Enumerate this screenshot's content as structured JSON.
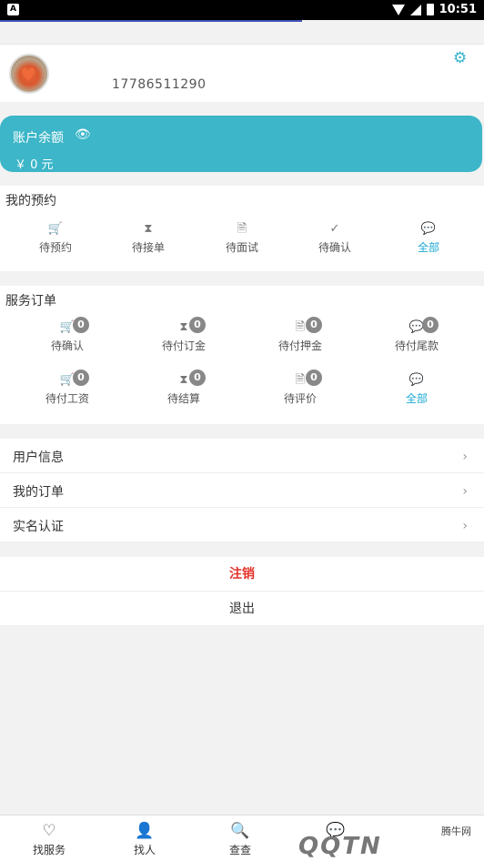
{
  "statusbar": {
    "time": "10:51",
    "app_icon": "A"
  },
  "profile": {
    "phone": "17786511290"
  },
  "balance": {
    "label": "账户余额",
    "amount": "￥ 0 元"
  },
  "appointments": {
    "title": "我的预约",
    "items": [
      {
        "label": "待预约",
        "icon": "cart-icon"
      },
      {
        "label": "待接单",
        "icon": "hourglass-icon"
      },
      {
        "label": "待面试",
        "icon": "document-icon"
      },
      {
        "label": "待确认",
        "icon": "check-icon"
      },
      {
        "label": "全部",
        "icon": "chat-icon"
      }
    ]
  },
  "service_orders": {
    "title": "服务订单",
    "items": [
      {
        "label": "待确认",
        "badge": "0",
        "icon": "cart-icon"
      },
      {
        "label": "待付订金",
        "badge": "0",
        "icon": "hourglass-icon"
      },
      {
        "label": "待付押金",
        "badge": "0",
        "icon": "document-icon"
      },
      {
        "label": "待付尾款",
        "badge": "0",
        "icon": "chat-icon"
      },
      {
        "label": "待付工资",
        "badge": "0",
        "icon": "cart-icon"
      },
      {
        "label": "待结算",
        "badge": "0",
        "icon": "hourglass-icon"
      },
      {
        "label": "待评价",
        "badge": "0",
        "icon": "document-icon"
      },
      {
        "label": "全部",
        "icon": "chat-icon"
      }
    ]
  },
  "menu": [
    {
      "label": "用户信息"
    },
    {
      "label": "我的订单"
    },
    {
      "label": "实名认证"
    }
  ],
  "actions": {
    "cancel": "注销",
    "logout": "退出"
  },
  "tabbar": [
    {
      "label": "找服务",
      "icon": "heart-icon"
    },
    {
      "label": "找人",
      "icon": "person-icon"
    },
    {
      "label": "查查",
      "icon": "search-document-icon"
    },
    {
      "label": "",
      "icon": "chat-icon"
    }
  ],
  "watermark": {
    "text": "腾牛网",
    "logo": "QQTN"
  },
  "colors": {
    "accent": "#3cb6c8",
    "link": "#1aa8d3",
    "danger": "#e5332a",
    "badge": "#888888"
  }
}
